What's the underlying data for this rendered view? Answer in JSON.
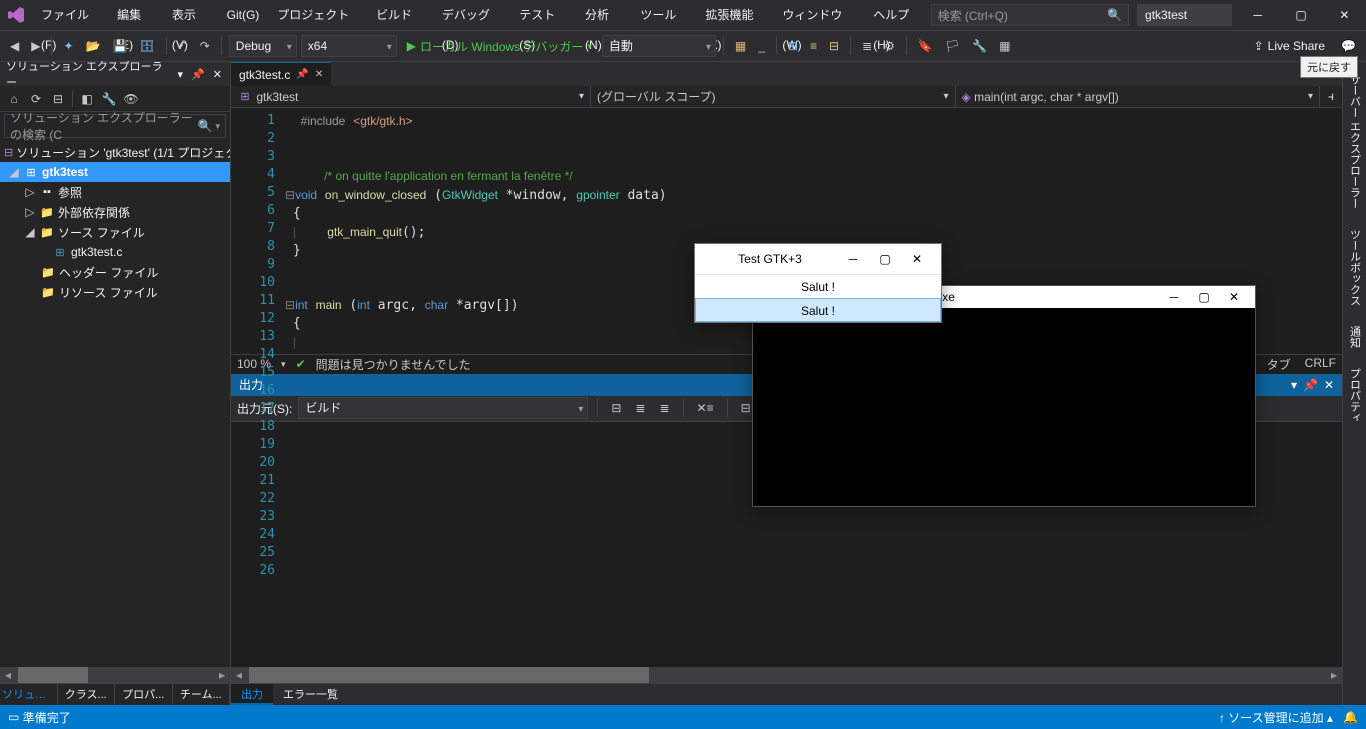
{
  "menu": [
    "ファイル(F)",
    "編集(E)",
    "表示(V)",
    "Git(G)",
    "プロジェクト(P)",
    "ビルド(B)",
    "デバッグ(D)",
    "テスト(S)",
    "分析(N)",
    "ツール(T)",
    "拡張機能(X)",
    "ウィンドウ(W)",
    "ヘルプ(H)"
  ],
  "search_placeholder": "検索 (Ctrl+Q)",
  "project_name": "gtk3test",
  "toolbar": {
    "config": "Debug",
    "platform": "x64",
    "run_label": "ローカル Windows デバッガー",
    "auto": "自動",
    "live_share": "Live Share"
  },
  "tooltip": "元に戻す",
  "solution": {
    "panel_title": "ソリューション エクスプローラー",
    "search_ph": "ソリューション エクスプローラー の検索 (C",
    "root": "ソリューション 'gtk3test' (1/1 プロジェクト",
    "proj": "gtk3test",
    "refs": "参照",
    "ext": "外部依存関係",
    "src": "ソース ファイル",
    "file": "gtk3test.c",
    "hdr": "ヘッダー ファイル",
    "res": "リソース ファイル",
    "tabs": [
      "ソリュー...",
      "クラス...",
      "プロパ...",
      "チーム..."
    ]
  },
  "editor": {
    "tab": "gtk3test.c",
    "nav1": "gtk3test",
    "nav2": "(グローバル スコープ)",
    "nav3": "main(int argc, char * argv[])",
    "zoom": "100 %",
    "no_issues": "問題は見つかりませんでした",
    "tabs_mode": "タブ",
    "crlf": "CRLF"
  },
  "output": {
    "title": "出力",
    "src_label": "出力元(S):",
    "src_value": "ビルド",
    "tabs": [
      "出力",
      "エラー一覧"
    ]
  },
  "right_tabs": [
    "サーバー エクスプローラー",
    "ツールボックス",
    "通知",
    "プロパティ"
  ],
  "statusbar": {
    "ready": "準備完了",
    "add_src": "ソース管理に追加"
  },
  "gtk_win": {
    "title": "Test GTK+3",
    "row1": "Salut !",
    "row2": "Salut !"
  },
  "console": {
    "path": "gtk3test¥x64¥Debug¥gtk3test.exe"
  }
}
